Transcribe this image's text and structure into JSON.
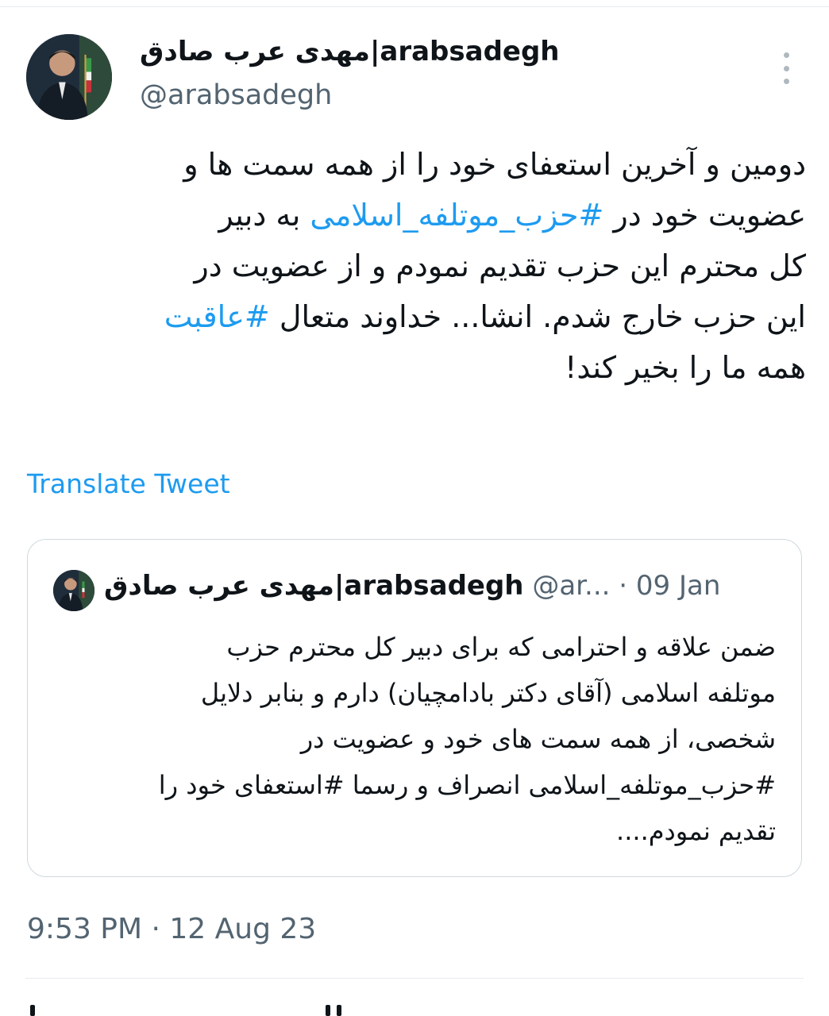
{
  "author": {
    "display_name": "مهدی عرب صادق|arabsadegh",
    "handle": "@arabsadegh"
  },
  "tweet": {
    "lines": [
      [
        {
          "text": "دومین و آخرین استعفای خود را از همه سمت ها و"
        }
      ],
      [
        {
          "text": "عضویت خود در "
        },
        {
          "text": "#حزب_موتلفه_اسلامی",
          "hashtag": true
        },
        {
          "text": " به دبیر"
        }
      ],
      [
        {
          "text": "کل محترم این حزب تقدیم نمودم و از عضویت در"
        }
      ],
      [
        {
          "text": "این حزب خارج شدم. انشا... خداوند متعال "
        },
        {
          "text": "#عاقبت",
          "hashtag": true
        }
      ],
      [
        {
          "text": "همه ما را بخیر کند!"
        }
      ]
    ],
    "translate_label": "Translate Tweet",
    "timestamp": "9:53 PM · 12 Aug 23"
  },
  "quoted_tweet": {
    "display_name": "مهدی عرب صادق|arabsadegh",
    "handle": "@ar...",
    "separator": "·",
    "date": "09 Jan",
    "lines": [
      "ضمن علاقه و احترامی که برای دبیر کل محترم حزب",
      "موتلفه اسلامی (آقای دکتر بادامچیان) دارم و بنابر دلایل",
      "شخصی، از همه سمت های خود و عضویت در",
      "#حزب_موتلفه_اسلامی انصراف و رسما #استعفای خود را",
      "تقدیم نمودم...."
    ]
  },
  "icons": {
    "more": "more-options-icon",
    "avatar": "profile-photo"
  },
  "colors": {
    "link": "#1d9bf0",
    "text": "#0f1419",
    "muted": "#536471",
    "border": "#cfd9de"
  }
}
